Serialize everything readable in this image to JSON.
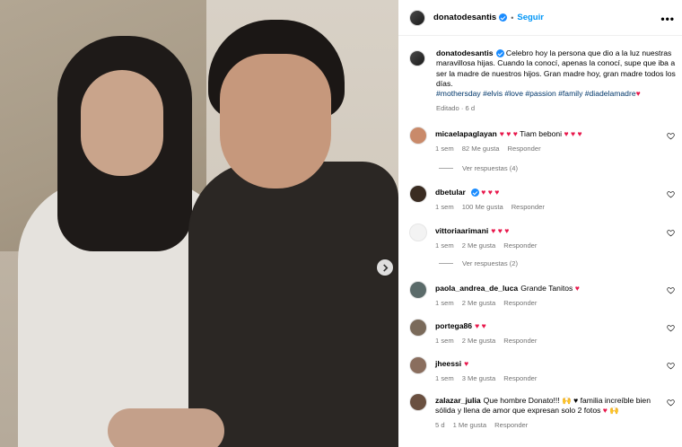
{
  "post": {
    "username": "donatodesantis",
    "follow_label": "Seguir",
    "separator": "•",
    "more_label": "•••",
    "caption_text": "Celebro hoy la persona que dio a la luz nuestras maravillosa hijas. Cuando la conocí, apenas la conocí, supe que iba a ser la madre de nuestros hijos. Gran madre hoy, gran madre todos los días.",
    "hashtags": "#mothersday #elvis #love #passion #family #diadelamadre",
    "caption_heart": "♥",
    "meta": "Editado · 6 d"
  },
  "comments": [
    {
      "user": "micaelapaglayan",
      "text_pre": "♥ ♥ ♥",
      "text": " Tiam beboni ",
      "text_post": "♥ ♥ ♥",
      "time": "1 sem",
      "likes": "82 Me gusta",
      "reply": "Responder",
      "avatar_color": "#c98a6a"
    },
    {
      "user": "dbetular",
      "text_pre": "",
      "text": "",
      "text_post": "♥ ♥ ♥",
      "time": "1 sem",
      "likes": "100 Me gusta",
      "reply": "Responder",
      "avatar_color": "#3a2c22",
      "verified": true
    },
    {
      "user": "vittoriaarimani",
      "text_pre": "",
      "text": "",
      "text_post": "♥ ♥ ♥",
      "time": "1 sem",
      "likes": "2 Me gusta",
      "reply": "Responder",
      "avatar_color": "#f3f3f3"
    },
    {
      "user": "paola_andrea_de_luca",
      "text_pre": "",
      "text": "Grande Tanitos ",
      "text_post": "♥",
      "time": "1 sem",
      "likes": "2 Me gusta",
      "reply": "Responder",
      "avatar_color": "#5b6b6a"
    },
    {
      "user": "portega86",
      "text_pre": "",
      "text": "",
      "text_post": "♥ ♥",
      "time": "1 sem",
      "likes": "2 Me gusta",
      "reply": "Responder",
      "avatar_color": "#7a6a5a"
    },
    {
      "user": "jheessi",
      "text_pre": "",
      "text": "",
      "text_post": "♥",
      "time": "1 sem",
      "likes": "3 Me gusta",
      "reply": "Responder",
      "avatar_color": "#8a6e5e"
    },
    {
      "user": "zalazar_julia",
      "text_pre": "",
      "text": "Que hombre Donato!!! 🙌 ♥ familia increíble bien sólida y llena de amor que expresan solo 2 fotos ",
      "text_post": "♥ 🙌",
      "time": "5 d",
      "likes": "1 Me gusta",
      "reply": "Responder",
      "avatar_color": "#6a5040"
    }
  ],
  "replies": [
    {
      "label": "Ver respuestas (4)"
    },
    {
      "label": "Ver respuestas (2)"
    }
  ]
}
